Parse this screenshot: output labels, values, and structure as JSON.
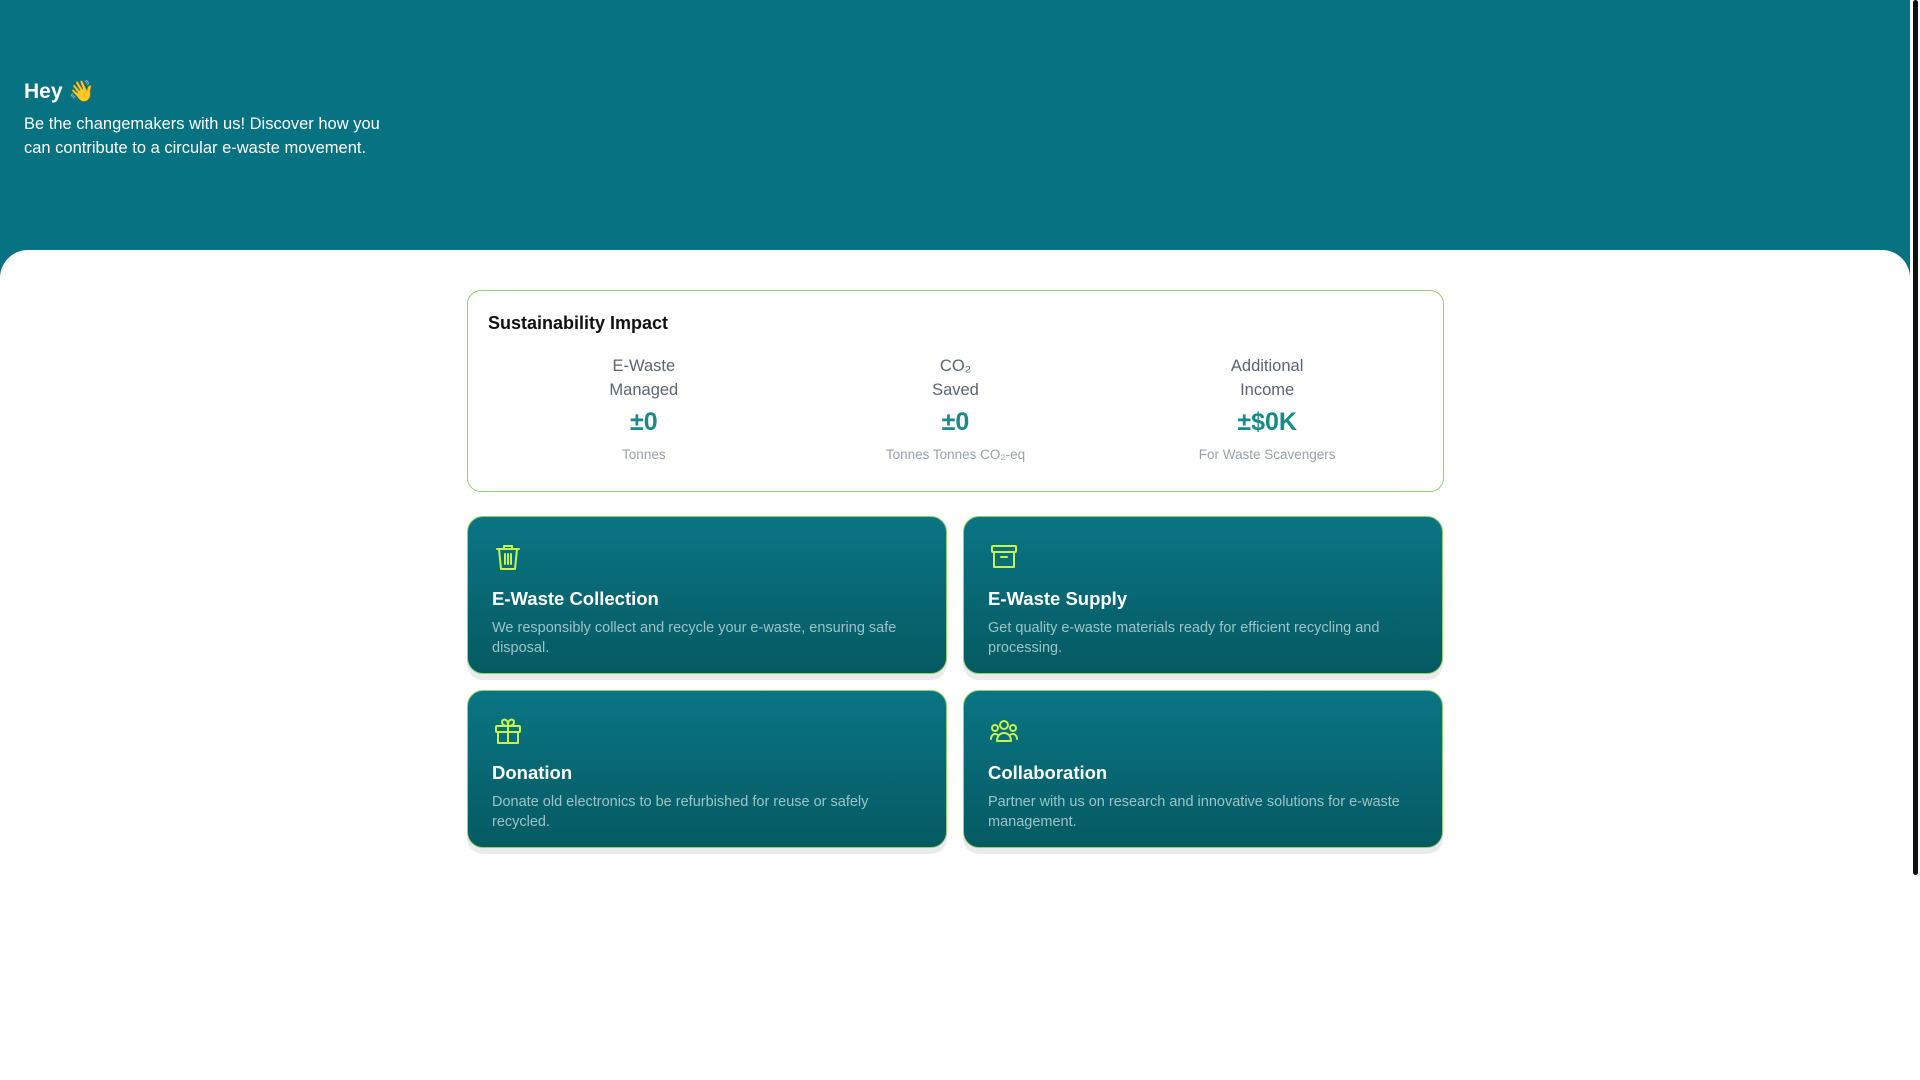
{
  "hero": {
    "greeting": "Hey",
    "wave_emoji": "👋",
    "intro": "Be the changemakers with us! Discover how you can contribute to a circular e-waste movement."
  },
  "impact": {
    "title": "Sustainability Impact",
    "stats": [
      {
        "label_line1": "E-Waste",
        "label_line2": "Managed",
        "value": "±0",
        "unit": "Tonnes"
      },
      {
        "label_line1": "CO₂",
        "label_line2": "Saved",
        "value": "±0",
        "unit": "Tonnes Tonnes CO₂-eq"
      },
      {
        "label_line1": "Additional",
        "label_line2": "Income",
        "value": "±$0K",
        "unit": "For Waste Scavengers"
      }
    ]
  },
  "cards": [
    {
      "icon": "trash-icon",
      "title": "E-Waste Collection",
      "desc": "We responsibly collect and recycle your e-waste, ensuring safe disposal."
    },
    {
      "icon": "archive-box-icon",
      "title": "E-Waste Supply",
      "desc": "Get quality e-waste materials ready for efficient recycling and processing."
    },
    {
      "icon": "gift-icon",
      "title": "Donation",
      "desc": "Donate old electronics to be refurbished for reuse or safely recycled."
    },
    {
      "icon": "users-icon",
      "title": "Collaboration",
      "desc": "Partner with us on research and innovative solutions for e-waste management."
    }
  ],
  "colors": {
    "hero_bg": "#077282",
    "accent_green": "#8fd16a",
    "icon_lime": "#c6f24e",
    "stat_value": "#178a8a"
  }
}
